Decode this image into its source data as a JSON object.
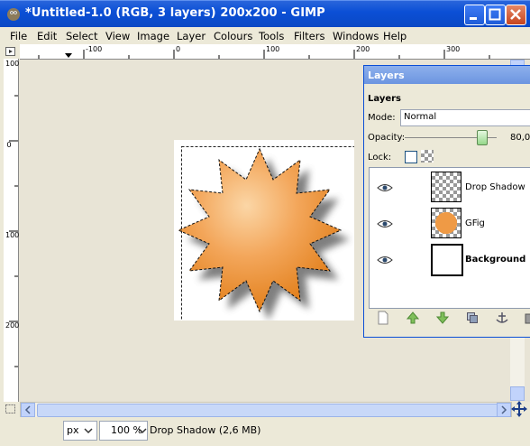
{
  "window": {
    "title": "*Untitled-1.0 (RGB, 3 layers) 200x200 - GIMP"
  },
  "menu": [
    "File",
    "Edit",
    "Select",
    "View",
    "Image",
    "Layer",
    "Colours",
    "Tools",
    "Filters",
    "Windows",
    "Help"
  ],
  "ruler": {
    "top": [
      "-100",
      "0",
      "100",
      "200",
      "300"
    ],
    "left": [
      "100",
      "0",
      "100",
      "200"
    ]
  },
  "status": {
    "unit": "px",
    "zoom": "100 %",
    "text": "Drop Shadow (2,6 MB)"
  },
  "layers_dialog": {
    "title": "Layers",
    "heading": "Layers",
    "mode_label": "Mode:",
    "mode_value": "Normal",
    "opacity_label": "Opacity:",
    "opacity_value": "80,0",
    "lock_label": "Lock:",
    "layers": [
      {
        "name": "Drop Shadow",
        "bold": false,
        "visible": true
      },
      {
        "name": "GFig",
        "bold": false,
        "visible": true
      },
      {
        "name": "Background",
        "bold": true,
        "visible": true
      }
    ]
  },
  "colors": {
    "titlebar": "#0B4FD6",
    "star_light": "#F9C58A",
    "star_dark": "#E37F16"
  }
}
